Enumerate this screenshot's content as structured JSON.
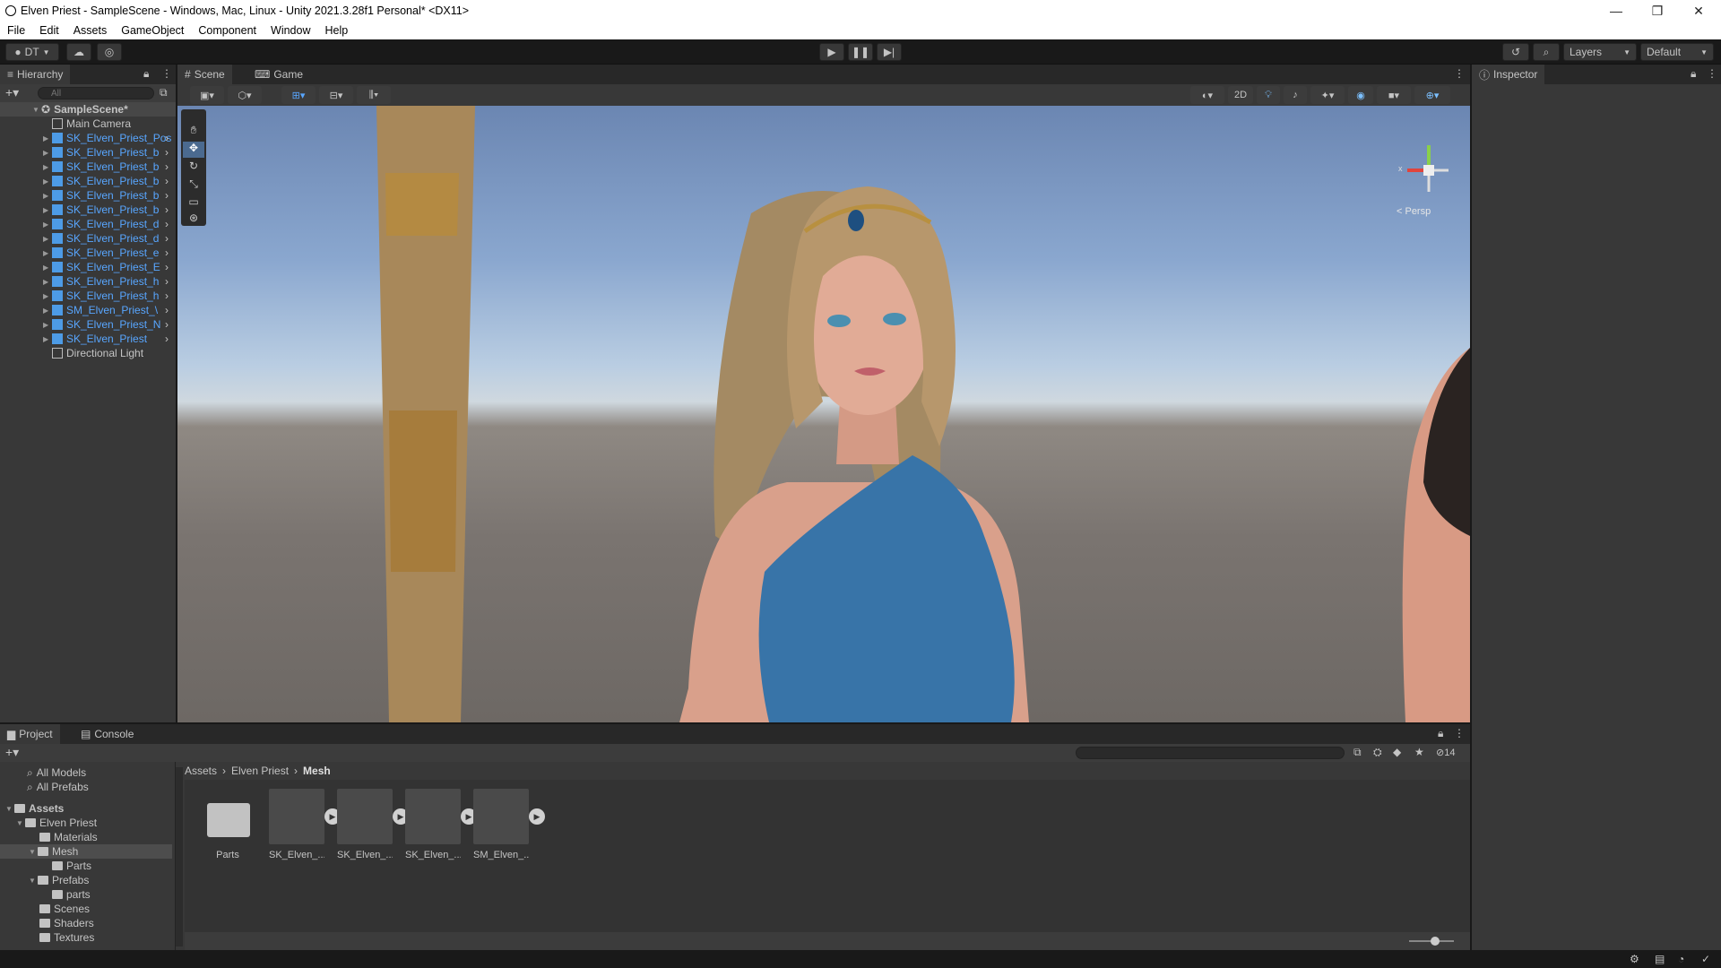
{
  "window": {
    "title": "Elven Priest - SampleScene - Windows, Mac, Linux - Unity 2021.3.28f1 Personal* <DX11>",
    "minimize": "—",
    "maximize": "❐",
    "close": "✕"
  },
  "menu": [
    "File",
    "Edit",
    "Assets",
    "GameObject",
    "Component",
    "Window",
    "Help"
  ],
  "toolbar": {
    "account": "DT",
    "layers": "Layers",
    "layout": "Default"
  },
  "hierarchy": {
    "tab": "Hierarchy",
    "search_placeholder": "All",
    "scene": "SampleScene*",
    "items": [
      "Main Camera",
      "SK_Elven_Priest_Pos",
      "SK_Elven_Priest_b",
      "SK_Elven_Priest_b",
      "SK_Elven_Priest_b",
      "SK_Elven_Priest_b",
      "SK_Elven_Priest_b",
      "SK_Elven_Priest_d",
      "SK_Elven_Priest_d",
      "SK_Elven_Priest_e",
      "SK_Elven_Priest_E",
      "SK_Elven_Priest_h",
      "SK_Elven_Priest_h",
      "SM_Elven_Priest_\\",
      "SK_Elven_Priest_N",
      "SK_Elven_Priest",
      "Directional Light"
    ]
  },
  "scene": {
    "tab_scene": "Scene",
    "tab_game": "Game",
    "mode_2d": "2D",
    "persp": "< Persp",
    "gizmo_x": "x"
  },
  "inspector": {
    "tab": "Inspector"
  },
  "project": {
    "tab_project": "Project",
    "tab_console": "Console",
    "favorites": [
      "All Models",
      "All Prefabs"
    ],
    "tree_root": "Assets",
    "tree": [
      "Elven Priest",
      "Materials",
      "Mesh",
      "Parts",
      "Prefabs",
      "parts",
      "Scenes",
      "Shaders",
      "Textures"
    ],
    "breadcrumb": [
      "Assets",
      "Elven Priest",
      "Mesh"
    ],
    "hidden_count": "14",
    "assets": [
      "Parts",
      "SK_Elven_...",
      "SK_Elven_...",
      "SK_Elven_...",
      "SM_Elven_..."
    ]
  }
}
